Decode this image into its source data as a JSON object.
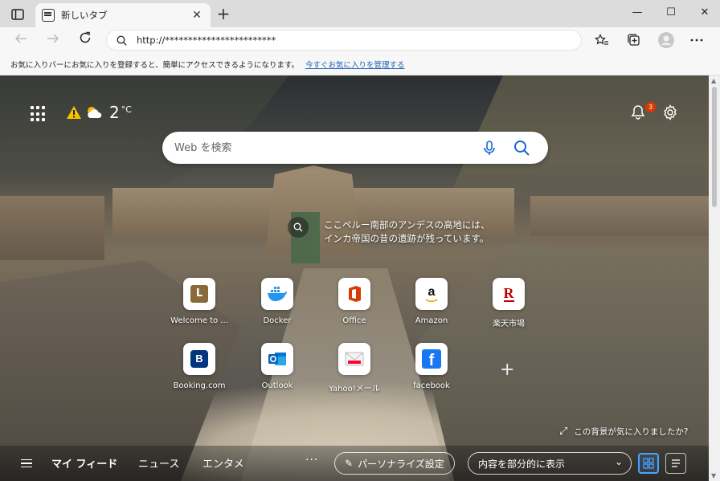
{
  "tab": {
    "title": "新しいタブ",
    "close": "✕"
  },
  "newtab": "+",
  "window": {
    "minimize": "—",
    "maximize": "☐",
    "close": "✕"
  },
  "address": {
    "url": "http://************************"
  },
  "favbar": {
    "message": "お気に入りバーにお気に入りを登録すると、簡単にアクセスできるようになります。",
    "link": "今すぐお気に入りを管理する"
  },
  "weather": {
    "temperature": "2",
    "unit": "°C"
  },
  "notifications": {
    "count": "3"
  },
  "search": {
    "placeholder": "Web を検索"
  },
  "image_info": {
    "line1": "ここペルー南部のアンデスの高地には、",
    "line2": "インカ帝国の昔の遺跡が残っています。"
  },
  "quicklinks": [
    {
      "label": "Welcome to ...",
      "glyph": "L",
      "color": "#8a6a3a"
    },
    {
      "label": "Docker",
      "glyph": "🐳",
      "color": "#2496ed"
    },
    {
      "label": "Office",
      "glyph": "O",
      "color": "#d83b01"
    },
    {
      "label": "Amazon",
      "glyph": "a",
      "color": "#111111"
    },
    {
      "label": "楽天市場",
      "glyph": "R",
      "color": "#bf0000"
    },
    {
      "label": "Booking.com",
      "glyph": "B",
      "color": "#003580"
    },
    {
      "label": "Outlook",
      "glyph": "O",
      "color": "#0364b8"
    },
    {
      "label": "Yahoo!メール",
      "glyph": "✉",
      "color": "#ff0033"
    },
    {
      "label": "facebook",
      "glyph": "f",
      "color": "#1877f2"
    }
  ],
  "like_bg": {
    "text": "この背景が気に入りましたか?"
  },
  "feed": {
    "tabs": [
      "マイ フィード",
      "ニュース",
      "エンタメ"
    ],
    "more": "···",
    "personalize": "パーソナライズ設定",
    "content_mode": "内容を部分的に表示"
  }
}
